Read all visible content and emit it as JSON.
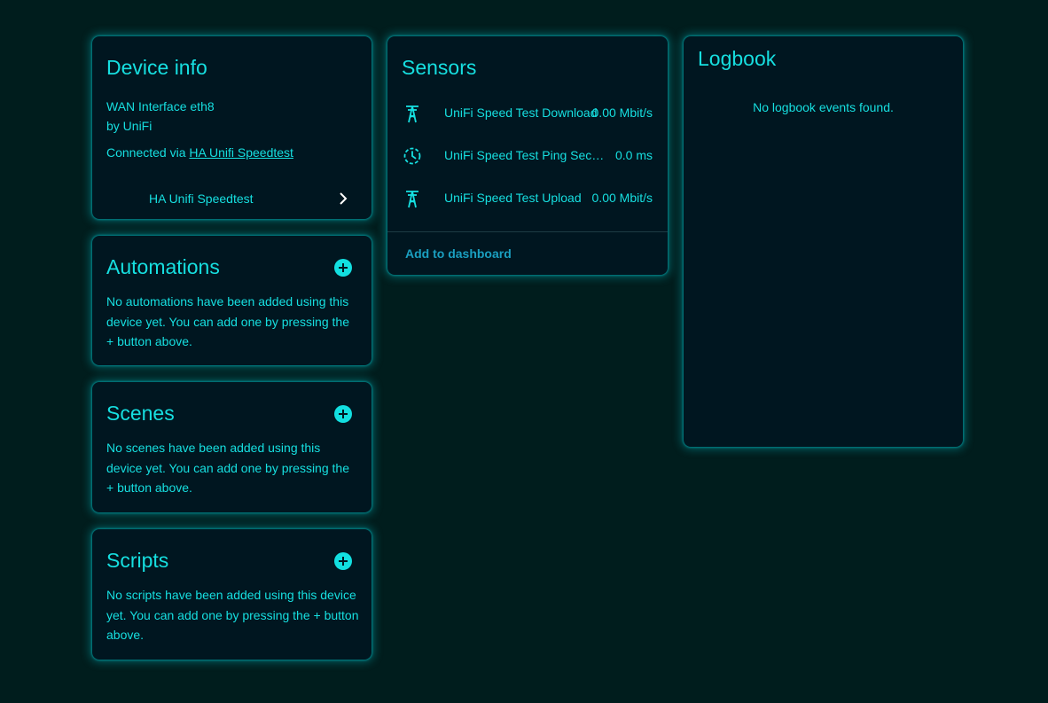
{
  "device_info": {
    "title": "Device info",
    "model": "WAN Interface eth8",
    "manufacturer": "by UniFi",
    "connected_prefix": "Connected via",
    "connected_link": "HA Unifi Speedtest",
    "integration_row": "HA Unifi Speedtest"
  },
  "automations": {
    "title": "Automations",
    "empty_text": "No automations have been added using this device yet. You can add one by pressing the + button above."
  },
  "scenes": {
    "title": "Scenes",
    "empty_text": "No scenes have been added using this device yet. You can add one by pressing the + button above."
  },
  "scripts": {
    "title": "Scripts",
    "empty_text": "No scripts have been added using this device yet. You can add one by pressing the + button above."
  },
  "sensors": {
    "title": "Sensors",
    "items": [
      {
        "name": "UniFi Speed Test Download",
        "value": "0.00 Mbit/s",
        "icon": "transmission-tower-icon"
      },
      {
        "name": "UniFi Speed Test Ping Seconds",
        "value": "0.0 ms",
        "icon": "timer-icon"
      },
      {
        "name": "UniFi Speed Test Upload",
        "value": "0.00 Mbit/s",
        "icon": "transmission-tower-icon"
      }
    ],
    "add_to_dashboard": "Add to dashboard"
  },
  "logbook": {
    "title": "Logbook",
    "empty_text": "No logbook events found."
  },
  "colors": {
    "background": "#001d1d",
    "card": "#001620",
    "accent": "#16dfe0",
    "link_button": "#1a9fc0"
  }
}
